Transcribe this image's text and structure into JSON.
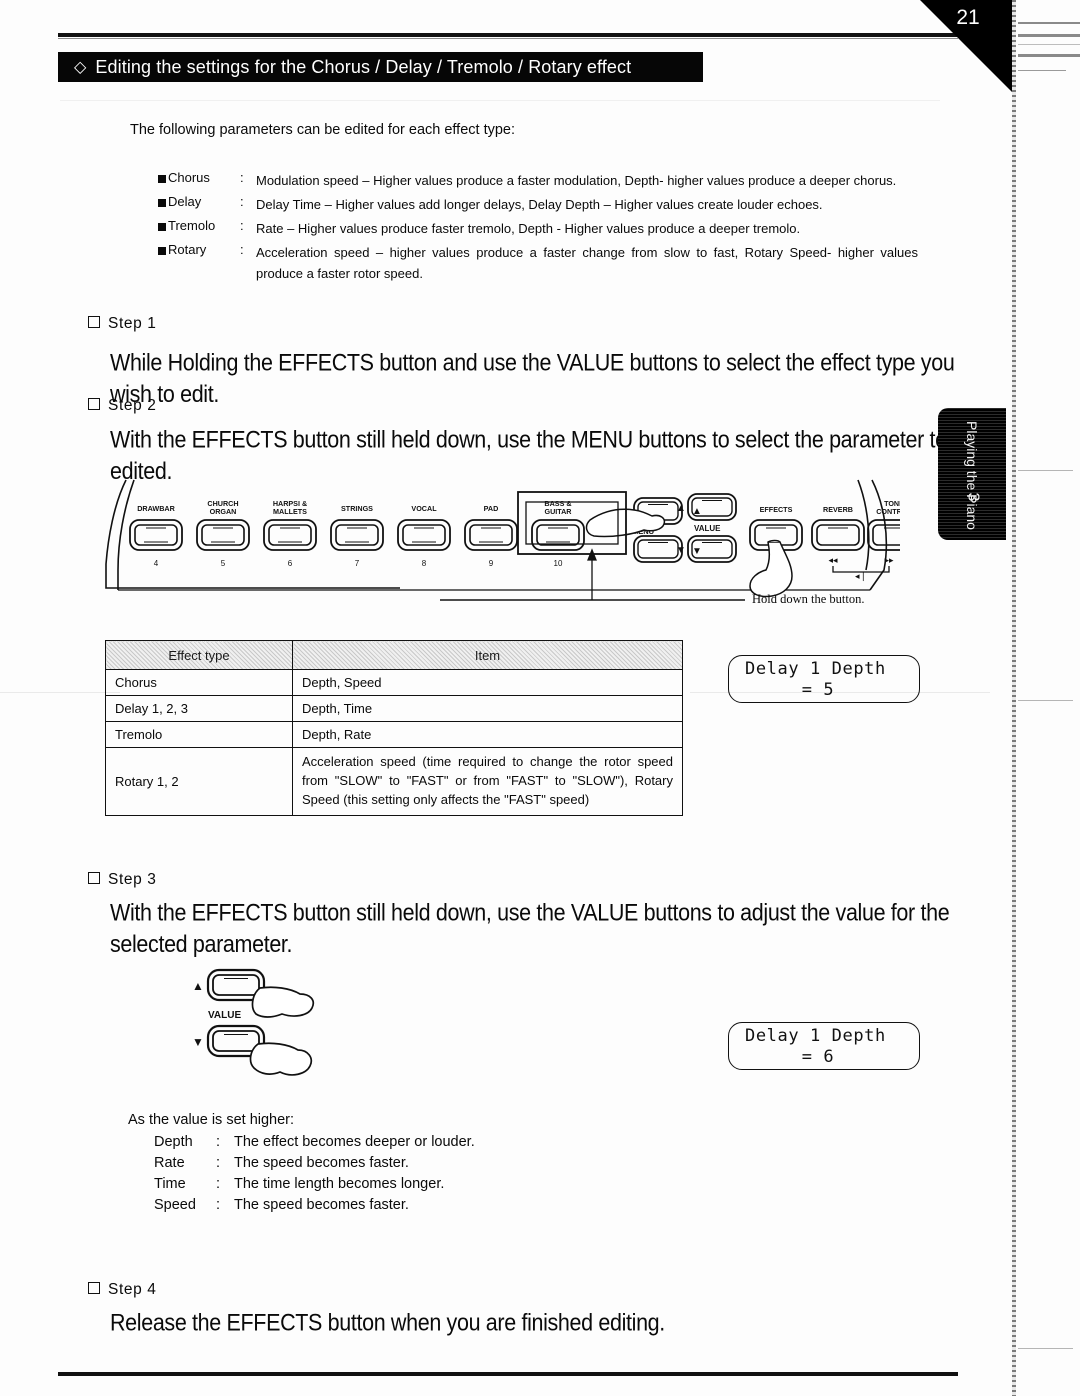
{
  "page": {
    "number": "21",
    "side_tab_label": "Playing the Piano",
    "side_tab_number": "3"
  },
  "header": {
    "diamond": "◇",
    "title": "Editing the settings for the Chorus / Delay / Tremolo / Rotary effect"
  },
  "intro": "The following parameters can be edited for each effect type:",
  "parameters": [
    {
      "name": "Chorus",
      "colon": ":",
      "description": "Modulation speed – Higher values produce a faster modulation, Depth- higher values produce a deeper chorus."
    },
    {
      "name": "Delay",
      "colon": ":",
      "description": "Delay Time – Higher values add longer delays, Delay Depth – Higher values create louder echoes."
    },
    {
      "name": "Tremolo",
      "colon": ":",
      "description": "Rate – Higher values produce faster tremolo, Depth - Higher values produce a deeper tremolo."
    },
    {
      "name": "Rotary",
      "colon": ":",
      "description": "Acceleration speed – higher values produce a faster change from slow to fast, Rotary Speed- higher values produce a faster rotor speed."
    }
  ],
  "steps": [
    {
      "label": "Step 1",
      "body": "While Holding the EFFECTS button and use the VALUE buttons to select the effect type you wish to edit."
    },
    {
      "label": "Step 2",
      "body": "With the EFFECTS button still held down, use the MENU buttons to select the parameter to be edited."
    },
    {
      "label": "Step 3",
      "body": "With the EFFECTS button still held down, use the VALUE buttons to adjust the value for the selected parameter."
    },
    {
      "label": "Step 4",
      "body": "Release the EFFECTS button when you are finished editing."
    }
  ],
  "panel": {
    "tone_buttons": [
      {
        "label_line1": "DRAWBAR",
        "label_line2": "",
        "number": "4"
      },
      {
        "label_line1": "CHURCH",
        "label_line2": "ORGAN",
        "number": "5"
      },
      {
        "label_line1": "HARPSI &",
        "label_line2": "MALLETS",
        "number": "6"
      },
      {
        "label_line1": "STRINGS",
        "label_line2": "",
        "number": "7"
      },
      {
        "label_line1": "VOCAL",
        "label_line2": "",
        "number": "8"
      },
      {
        "label_line1": "PAD",
        "label_line2": "",
        "number": "9"
      },
      {
        "label_line1": "BASS &",
        "label_line2": "GUITAR",
        "number": "10"
      }
    ],
    "menu_label": "MENU",
    "menu_up_icon": "▲",
    "menu_down_icon": "▼",
    "value_label": "VALUE",
    "value_up_icon": "▲",
    "value_down_icon": "▼",
    "right_buttons": [
      {
        "label_line1": "EFFECTS",
        "label_line2": ""
      },
      {
        "label_line1": "REVERB",
        "label_line2": ""
      },
      {
        "label_line1": "TONE",
        "label_line2": "CONTROL"
      }
    ],
    "transport_rewind": "◂◂",
    "transport_forward": "▸▸",
    "transport_prev": "◂❘",
    "callout": "Hold down the button."
  },
  "table": {
    "headers": [
      "Effect type",
      "Item"
    ],
    "rows": [
      {
        "type": "Chorus",
        "item": "Depth, Speed"
      },
      {
        "type": "Delay 1, 2, 3",
        "item": "Depth, Time"
      },
      {
        "type": "Tremolo",
        "item": "Depth, Rate"
      },
      {
        "type": "Rotary 1, 2",
        "item": "Acceleration speed (time required to change the rotor speed from \"SLOW\" to \"FAST\" or from \"FAST\" to \"SLOW\"), Rotary Speed (this setting only affects the \"FAST\" speed)"
      }
    ]
  },
  "lcd_screens": [
    {
      "line1": "Delay 1 Depth",
      "line2": "= 5"
    },
    {
      "line1": "Delay 1 Depth",
      "line2": "= 6"
    }
  ],
  "value_note": {
    "title": "As the value is set higher:",
    "rows": [
      {
        "key": "Depth",
        "colon": ":",
        "text": "The effect becomes deeper or louder."
      },
      {
        "key": "Rate",
        "colon": ":",
        "text": "The speed becomes faster."
      },
      {
        "key": "Time",
        "colon": ":",
        "text": "The time length becomes longer."
      },
      {
        "key": "Speed",
        "colon": ":",
        "text": "The speed becomes faster."
      }
    ]
  }
}
